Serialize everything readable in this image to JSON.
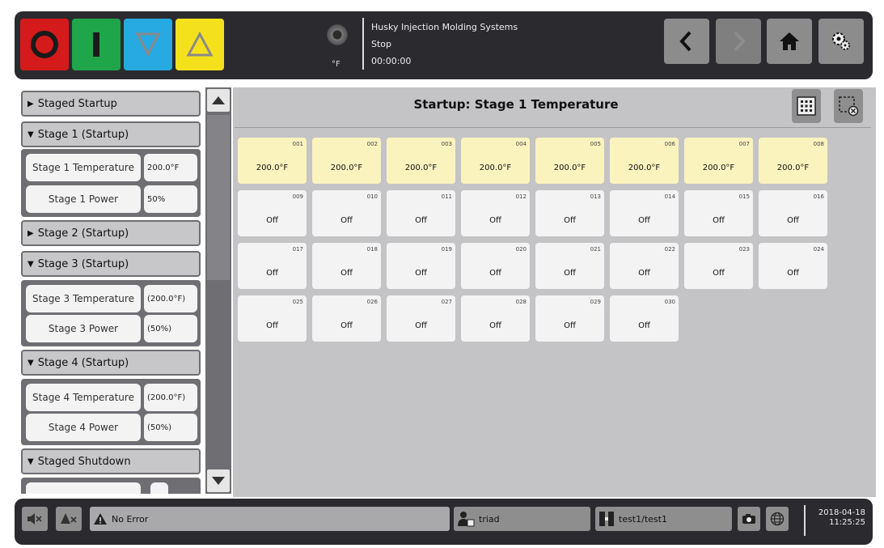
{
  "colors": {
    "stop": "#d41a1a",
    "start": "#1fa54a",
    "down": "#27a9e1",
    "up": "#f5e11b",
    "zone_active": "#faf3be",
    "zone_inactive": "#f3f3f3"
  },
  "header": {
    "temp_unit": "°F",
    "company": "Husky Injection Molding Systems",
    "machine_state": "Stop",
    "cycle_time": "00:00:00",
    "icons": [
      "stop-icon",
      "start-icon",
      "down-arrow-icon",
      "up-arrow-icon",
      "back-icon",
      "forward-icon",
      "home-icon",
      "settings-icon"
    ]
  },
  "sidebar": {
    "staged_startup": "Staged Startup",
    "stage1": {
      "title": "Stage 1 (Startup)",
      "temp_label": "Stage 1 Temperature",
      "temp_value": "200.0°F",
      "power_label": "Stage 1 Power",
      "power_value": "50%"
    },
    "stage2": {
      "title": "Stage 2 (Startup)"
    },
    "stage3": {
      "title": "Stage 3 (Startup)",
      "temp_label": "Stage 3 Temperature",
      "temp_value": "(200.0°F)",
      "power_label": "Stage 3 Power",
      "power_value": "(50%)"
    },
    "stage4": {
      "title": "Stage 4 (Startup)",
      "temp_label": "Stage 4 Temperature",
      "temp_value": "(200.0°F)",
      "power_label": "Stage 4 Power",
      "power_value": "(50%)"
    },
    "staged_shutdown": "Staged Shutdown"
  },
  "main": {
    "title": "Startup: Stage 1 Temperature",
    "zones": [
      {
        "id": "001",
        "value": "200.0°F",
        "active": true
      },
      {
        "id": "002",
        "value": "200.0°F",
        "active": true
      },
      {
        "id": "003",
        "value": "200.0°F",
        "active": true
      },
      {
        "id": "004",
        "value": "200.0°F",
        "active": true
      },
      {
        "id": "005",
        "value": "200.0°F",
        "active": true
      },
      {
        "id": "006",
        "value": "200.0°F",
        "active": true
      },
      {
        "id": "007",
        "value": "200.0°F",
        "active": true
      },
      {
        "id": "008",
        "value": "200.0°F",
        "active": true
      },
      {
        "id": "009",
        "value": "Off",
        "active": false
      },
      {
        "id": "010",
        "value": "Off",
        "active": false
      },
      {
        "id": "011",
        "value": "Off",
        "active": false
      },
      {
        "id": "012",
        "value": "Off",
        "active": false
      },
      {
        "id": "013",
        "value": "Off",
        "active": false
      },
      {
        "id": "014",
        "value": "Off",
        "active": false
      },
      {
        "id": "015",
        "value": "Off",
        "active": false
      },
      {
        "id": "016",
        "value": "Off",
        "active": false
      },
      {
        "id": "017",
        "value": "Off",
        "active": false
      },
      {
        "id": "018",
        "value": "Off",
        "active": false
      },
      {
        "id": "019",
        "value": "Off",
        "active": false
      },
      {
        "id": "020",
        "value": "Off",
        "active": false
      },
      {
        "id": "021",
        "value": "Off",
        "active": false
      },
      {
        "id": "022",
        "value": "Off",
        "active": false
      },
      {
        "id": "023",
        "value": "Off",
        "active": false
      },
      {
        "id": "024",
        "value": "Off",
        "active": false
      },
      {
        "id": "025",
        "value": "Off",
        "active": false
      },
      {
        "id": "026",
        "value": "Off",
        "active": false
      },
      {
        "id": "027",
        "value": "Off",
        "active": false
      },
      {
        "id": "028",
        "value": "Off",
        "active": false
      },
      {
        "id": "029",
        "value": "Off",
        "active": false
      },
      {
        "id": "030",
        "value": "Off",
        "active": false
      }
    ]
  },
  "footer": {
    "alarm_text": "No Error",
    "user": "triad",
    "mold": "test1/test1",
    "date": "2018-04-18",
    "time": "11:25:25"
  }
}
